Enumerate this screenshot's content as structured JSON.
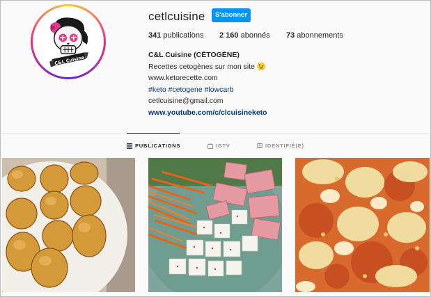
{
  "profile": {
    "username": "cetlcuisine",
    "follow_label": "S'abonner",
    "avatar_text": "C&L Cuisine"
  },
  "stats": {
    "posts_count": "341",
    "posts_label": " publications",
    "followers_count": "2 160",
    "followers_label": " abonnés",
    "following_count": "73",
    "following_label": " abonnements"
  },
  "bio": {
    "name": "C&L Cuisine (CÉTOGÈNE)",
    "line1": "Recettes cetogènes sur mon site 😉",
    "line2": "www.ketorecette.com",
    "hashtags": [
      "#keto",
      "#cetogene",
      "#lowcarb"
    ],
    "email": "cetlcuisine@gmail.com",
    "link": "www.youtube.com/c/clcuisineketo"
  },
  "tabs": [
    {
      "label": "PUBLICATIONS",
      "icon": "grid-icon",
      "active": true
    },
    {
      "label": "IGTV",
      "icon": "igtv-icon",
      "active": false
    },
    {
      "label": "IDENTIFIÉ(E)",
      "icon": "tagged-icon",
      "active": false
    }
  ],
  "posts": [
    {
      "subject": "madeleines",
      "icon": "post-image-madeleines"
    },
    {
      "subject": "salad-ham-feta",
      "icon": "post-image-salad"
    },
    {
      "subject": "pizza",
      "icon": "post-image-pizza"
    }
  ],
  "colors": {
    "accent": "#0095f6",
    "link": "#00376b",
    "divider": "#dbdbdb"
  }
}
